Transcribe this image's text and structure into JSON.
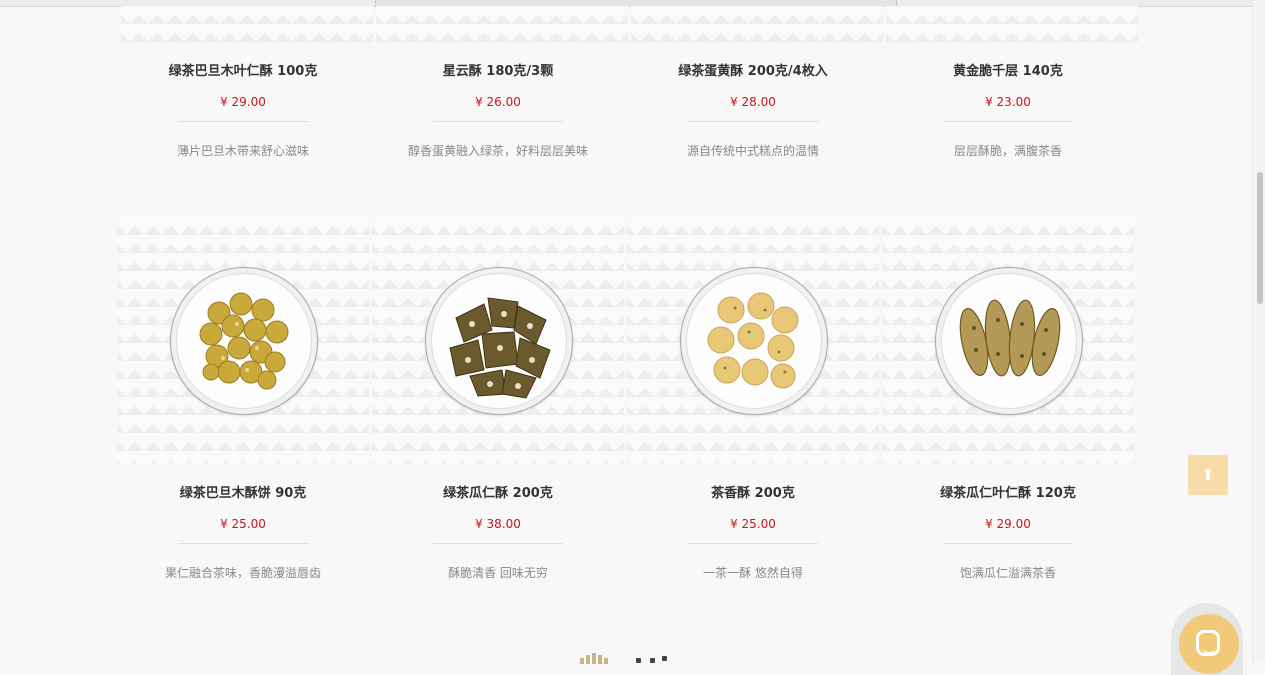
{
  "products_row1": [
    {
      "name": "绿茶巴旦木叶仁酥 100克",
      "price": "¥ 29.00",
      "desc": "薄片巴旦木带来舒心滋味"
    },
    {
      "name": "星云酥 180克/3颗",
      "price": "¥ 26.00",
      "desc": "醇香蛋黄融入绿茶，好料层层美味"
    },
    {
      "name": "绿茶蛋黄酥 200克/4枚入",
      "price": "¥ 28.00",
      "desc": "源自传统中式糕点的温情"
    },
    {
      "name": "黄金脆千层 140克",
      "price": "¥ 23.00",
      "desc": "层层酥脆，满腹茶香"
    }
  ],
  "products_row2": [
    {
      "name": "绿茶巴旦木酥饼 90克",
      "price": "¥ 25.00",
      "desc": "果仁融合茶味，香脆漫溢唇齿",
      "image": "almond-cookie-plate"
    },
    {
      "name": "绿茶瓜仁酥 200克",
      "price": "¥ 38.00",
      "desc": "酥脆清香 回味无穷",
      "image": "melon-seed-brittle-plate"
    },
    {
      "name": "茶香酥 200克",
      "price": "¥ 25.00",
      "desc": "一茶一酥 悠然自得",
      "image": "tea-shortbread-balls-plate"
    },
    {
      "name": "绿茶瓜仁叶仁酥 120克",
      "price": "¥ 29.00",
      "desc": "饱满瓜仁溢满茶香",
      "image": "leaf-pastry-plate"
    }
  ],
  "ui": {
    "back_to_top_icon": "arrow-up-icon",
    "back_to_top_symbol": "⬆",
    "chat_icon": "chat-face-icon"
  },
  "colors": {
    "price": "#c8161d",
    "accent": "#f7dba8",
    "chat": "#f2c978"
  }
}
